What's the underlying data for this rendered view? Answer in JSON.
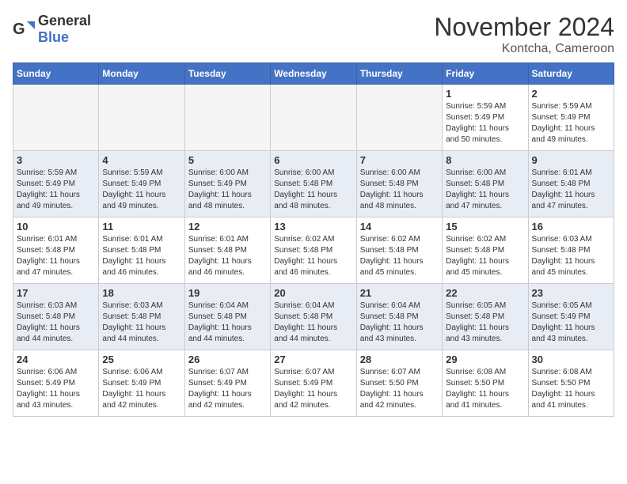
{
  "logo": {
    "general": "General",
    "blue": "Blue"
  },
  "title": "November 2024",
  "location": "Kontcha, Cameroon",
  "weekdays": [
    "Sunday",
    "Monday",
    "Tuesday",
    "Wednesday",
    "Thursday",
    "Friday",
    "Saturday"
  ],
  "weeks": [
    [
      {
        "day": "",
        "info": ""
      },
      {
        "day": "",
        "info": ""
      },
      {
        "day": "",
        "info": ""
      },
      {
        "day": "",
        "info": ""
      },
      {
        "day": "",
        "info": ""
      },
      {
        "day": "1",
        "info": "Sunrise: 5:59 AM\nSunset: 5:49 PM\nDaylight: 11 hours\nand 50 minutes."
      },
      {
        "day": "2",
        "info": "Sunrise: 5:59 AM\nSunset: 5:49 PM\nDaylight: 11 hours\nand 49 minutes."
      }
    ],
    [
      {
        "day": "3",
        "info": "Sunrise: 5:59 AM\nSunset: 5:49 PM\nDaylight: 11 hours\nand 49 minutes."
      },
      {
        "day": "4",
        "info": "Sunrise: 5:59 AM\nSunset: 5:49 PM\nDaylight: 11 hours\nand 49 minutes."
      },
      {
        "day": "5",
        "info": "Sunrise: 6:00 AM\nSunset: 5:49 PM\nDaylight: 11 hours\nand 48 minutes."
      },
      {
        "day": "6",
        "info": "Sunrise: 6:00 AM\nSunset: 5:48 PM\nDaylight: 11 hours\nand 48 minutes."
      },
      {
        "day": "7",
        "info": "Sunrise: 6:00 AM\nSunset: 5:48 PM\nDaylight: 11 hours\nand 48 minutes."
      },
      {
        "day": "8",
        "info": "Sunrise: 6:00 AM\nSunset: 5:48 PM\nDaylight: 11 hours\nand 47 minutes."
      },
      {
        "day": "9",
        "info": "Sunrise: 6:01 AM\nSunset: 5:48 PM\nDaylight: 11 hours\nand 47 minutes."
      }
    ],
    [
      {
        "day": "10",
        "info": "Sunrise: 6:01 AM\nSunset: 5:48 PM\nDaylight: 11 hours\nand 47 minutes."
      },
      {
        "day": "11",
        "info": "Sunrise: 6:01 AM\nSunset: 5:48 PM\nDaylight: 11 hours\nand 46 minutes."
      },
      {
        "day": "12",
        "info": "Sunrise: 6:01 AM\nSunset: 5:48 PM\nDaylight: 11 hours\nand 46 minutes."
      },
      {
        "day": "13",
        "info": "Sunrise: 6:02 AM\nSunset: 5:48 PM\nDaylight: 11 hours\nand 46 minutes."
      },
      {
        "day": "14",
        "info": "Sunrise: 6:02 AM\nSunset: 5:48 PM\nDaylight: 11 hours\nand 45 minutes."
      },
      {
        "day": "15",
        "info": "Sunrise: 6:02 AM\nSunset: 5:48 PM\nDaylight: 11 hours\nand 45 minutes."
      },
      {
        "day": "16",
        "info": "Sunrise: 6:03 AM\nSunset: 5:48 PM\nDaylight: 11 hours\nand 45 minutes."
      }
    ],
    [
      {
        "day": "17",
        "info": "Sunrise: 6:03 AM\nSunset: 5:48 PM\nDaylight: 11 hours\nand 44 minutes."
      },
      {
        "day": "18",
        "info": "Sunrise: 6:03 AM\nSunset: 5:48 PM\nDaylight: 11 hours\nand 44 minutes."
      },
      {
        "day": "19",
        "info": "Sunrise: 6:04 AM\nSunset: 5:48 PM\nDaylight: 11 hours\nand 44 minutes."
      },
      {
        "day": "20",
        "info": "Sunrise: 6:04 AM\nSunset: 5:48 PM\nDaylight: 11 hours\nand 44 minutes."
      },
      {
        "day": "21",
        "info": "Sunrise: 6:04 AM\nSunset: 5:48 PM\nDaylight: 11 hours\nand 43 minutes."
      },
      {
        "day": "22",
        "info": "Sunrise: 6:05 AM\nSunset: 5:48 PM\nDaylight: 11 hours\nand 43 minutes."
      },
      {
        "day": "23",
        "info": "Sunrise: 6:05 AM\nSunset: 5:49 PM\nDaylight: 11 hours\nand 43 minutes."
      }
    ],
    [
      {
        "day": "24",
        "info": "Sunrise: 6:06 AM\nSunset: 5:49 PM\nDaylight: 11 hours\nand 43 minutes."
      },
      {
        "day": "25",
        "info": "Sunrise: 6:06 AM\nSunset: 5:49 PM\nDaylight: 11 hours\nand 42 minutes."
      },
      {
        "day": "26",
        "info": "Sunrise: 6:07 AM\nSunset: 5:49 PM\nDaylight: 11 hours\nand 42 minutes."
      },
      {
        "day": "27",
        "info": "Sunrise: 6:07 AM\nSunset: 5:49 PM\nDaylight: 11 hours\nand 42 minutes."
      },
      {
        "day": "28",
        "info": "Sunrise: 6:07 AM\nSunset: 5:50 PM\nDaylight: 11 hours\nand 42 minutes."
      },
      {
        "day": "29",
        "info": "Sunrise: 6:08 AM\nSunset: 5:50 PM\nDaylight: 11 hours\nand 41 minutes."
      },
      {
        "day": "30",
        "info": "Sunrise: 6:08 AM\nSunset: 5:50 PM\nDaylight: 11 hours\nand 41 minutes."
      }
    ]
  ]
}
